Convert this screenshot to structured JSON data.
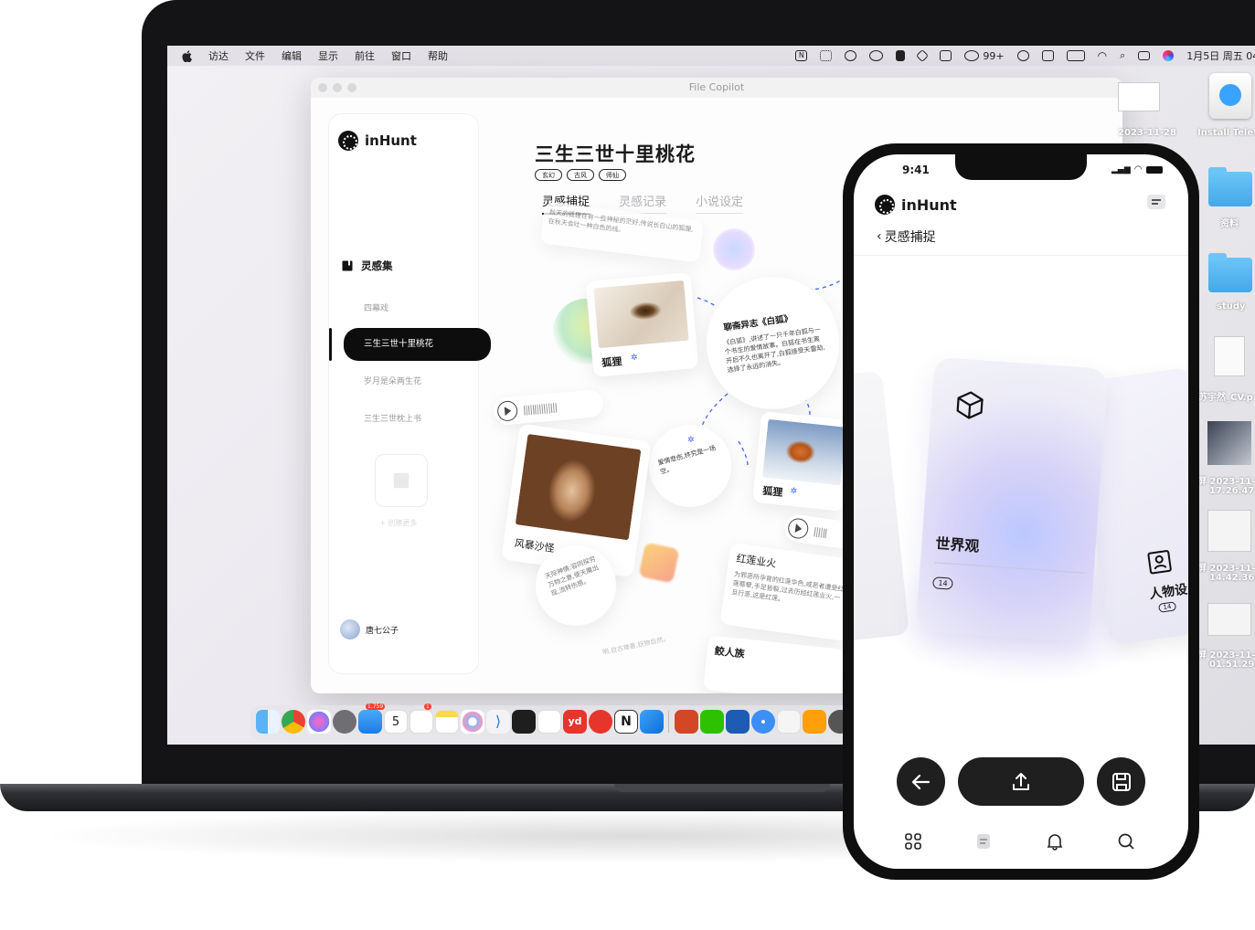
{
  "mac": {
    "menubar": {
      "items": [
        "访达",
        "文件",
        "编辑",
        "显示",
        "前往",
        "窗口",
        "帮助"
      ],
      "wechat_badge": "99+",
      "clock": "1月5日 周五 04:"
    },
    "window": {
      "title": "File Copilot",
      "brand": "inHunt",
      "sidebar": {
        "section_title": "灵感集",
        "items": [
          "四幕戏",
          "三生三世十里桃花",
          "岁月是朵两生花",
          "三生三世枕上书"
        ],
        "create_label": "+ 创建更多",
        "user_name": "唐七公子"
      },
      "canvas": {
        "title": "三生三世十里桃花",
        "tags": [
          "玄幻",
          "古风",
          "师仙"
        ],
        "tabs": [
          "灵感捕捉",
          "灵感记录",
          "小说设定"
        ],
        "top_note": "秋天的狐狸在有一些神秘的茫好,传说长白山的狐狸,在秋天会吐一种白色的线。",
        "card_fox_eye": "狐狸",
        "circle_story_title": "聊斋异志《白狐》",
        "circle_story_body": "《白狐》,讲述了一只千年白狐与一个书生的爱情故事。白狐在书生离开后不久也离开了,白狐接受天雷劫,选择了永远的消失。",
        "card_fox": "狐狸",
        "circle_small": "爱情悲伤,终究是一场空。",
        "card_sand": "风暴沙怪",
        "circle_bottom": "天际神情:容同探穷万物之意,使天魔出现,流转伤感。",
        "card_lotus_title": "红莲业火",
        "card_lotus_body": "为邪恶所孕育的红莲华色,咸恶者遭受红莲罪孽,手足皆裂,过去历经红莲业火,一旦行恶,这是红莲。",
        "card_jiao": "鲛人族",
        "bottom_note": "明,自古难善,妖物自然。"
      }
    },
    "desktop": {
      "items": [
        {
          "label": "2023-11-28"
        },
        {
          "label": "Install Telev"
        },
        {
          "label": "资料"
        },
        {
          "label": "study"
        },
        {
          "label": "苏宇然_CV.p"
        },
        {
          "label_line1": "屏 2023-11-",
          "label_line2": "17.26.47"
        },
        {
          "label_line1": "屏 2023-11-",
          "label_line2": "14.42.36"
        },
        {
          "label_line1": "屏 2023-11-",
          "label_line2": "01.51.29"
        }
      ]
    },
    "dock": {
      "calendar_day": "5",
      "mail_badge": "1,759",
      "reminders_badge": "1"
    }
  },
  "phone": {
    "time": "9:41",
    "brand": "inHunt",
    "back_label": "灵感捕捉",
    "main_card": {
      "title": "世界观",
      "count": "14"
    },
    "side_card": {
      "title": "人物设",
      "count": "14"
    }
  },
  "colors": {
    "accent_dark": "#0d0d0d",
    "folder_blue": "#4aaeea",
    "card_gradient": "#c8c6f4"
  }
}
